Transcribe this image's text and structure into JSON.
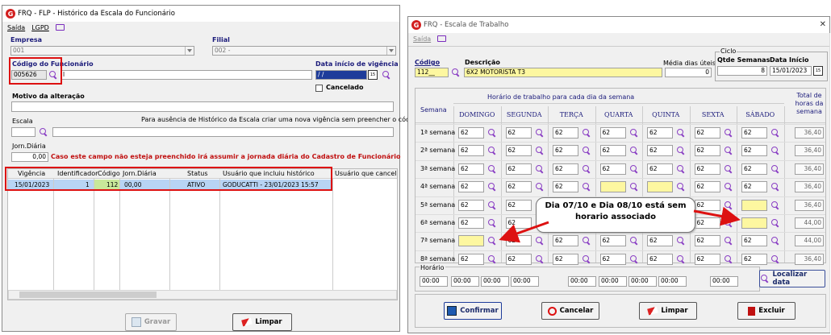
{
  "left": {
    "title": "FRQ - FLP - Histórico da Escala do Funcionário",
    "menu": [
      "Saída",
      "LGPD"
    ],
    "empresa_label": "Empresa",
    "empresa_value": "001",
    "filial_label": "Filial",
    "filial_value": "002 - ",
    "codigo_label": "Código do Funcionário",
    "codigo_value": "005626",
    "codigo_name": "l",
    "data_inicio_label": "Data início de vigência",
    "data_inicio_value": "/ /",
    "cancelado_label": "Cancelado",
    "motivo_label": "Motivo da alteração",
    "escala_label": "Escala",
    "escala_hint": "Para ausência de Histórico da Escala criar uma nova vigência sem preencher o código",
    "jorn_label": "Jorn.Diária",
    "jorn_value": "0,00",
    "jorn_warning": "Caso este campo não esteja preenchido irá assumir a jornada diária do Cadastro de Funcionário",
    "grid_headers": [
      "Vigência",
      "Identificador",
      "Código",
      "Jorn.Diária",
      "Status",
      "Usuário que incluiu histórico",
      "Usuário que cancel"
    ],
    "grid_row": [
      "15/01/2023",
      "1",
      "112",
      "00,00",
      "ATIVO",
      "GODUCATTI - 23/01/2023 15:57",
      ""
    ],
    "btn_gravar": "Gravar",
    "btn_limpar": "Limpar"
  },
  "right": {
    "title": "FRQ - Escala de Trabalho",
    "menu": [
      "Saída"
    ],
    "codigo_label": "Código",
    "codigo_value": "112__",
    "descricao_label": "Descrição",
    "descricao_value": "6X2 MOTORISTA T3",
    "media_label": "Média dias úteis",
    "media_value": "0",
    "ciclo_label": "Ciclo",
    "qtde_label": "Qtde Semanas",
    "qtde_value": "8",
    "data_inicio_label": "Data Início",
    "data_inicio_value": "15/01/2023",
    "horario_header": "Horário de trabalho para cada dia da semana",
    "semana_header": "Semana",
    "total_header": "Total de horas da semana",
    "days": [
      "DOMINGO",
      "SEGUNDA",
      "TERÇA",
      "QUARTA",
      "QUINTA",
      "SEXTA",
      "SÁBADO"
    ],
    "weeks": [
      {
        "label": "1ª semana",
        "cells": [
          "62",
          "62",
          "62",
          "62",
          "62",
          "62",
          "62"
        ],
        "total": "36,40"
      },
      {
        "label": "2ª semana",
        "cells": [
          "62",
          "62",
          "62",
          "62",
          "62",
          "62",
          "62"
        ],
        "total": "36,40"
      },
      {
        "label": "3ª semana",
        "cells": [
          "62",
          "62",
          "62",
          "62",
          "62",
          "62",
          "62"
        ],
        "total": "36,40"
      },
      {
        "label": "4ª semana",
        "cells": [
          "62",
          "62",
          "62",
          "",
          "",
          "62",
          "62"
        ],
        "total": "36,40"
      },
      {
        "label": "5ª semana",
        "cells": [
          "62",
          "62",
          "62",
          "62",
          "62",
          "62",
          ""
        ],
        "total": "36,40"
      },
      {
        "label": "6ª semana",
        "cells": [
          "62",
          "62",
          "62",
          "62",
          "62",
          "62",
          ""
        ],
        "total": "44,00"
      },
      {
        "label": "7ª semana",
        "cells": [
          "",
          "62",
          "62",
          "62",
          "62",
          "62",
          "62"
        ],
        "total": "44,00"
      },
      {
        "label": "8ª semana",
        "cells": [
          "62",
          "62",
          "62",
          "62",
          "62",
          "62",
          "62"
        ],
        "total": "36,40"
      }
    ],
    "horario_label": "Horário",
    "horario_values": [
      "00:00",
      "00:00",
      "00:00",
      "00:00",
      "00:00",
      "00:00",
      "00:00",
      "00:00",
      "00:00"
    ],
    "btn_localizar": "Localizar data",
    "btn_confirmar": "Confirmar",
    "btn_cancelar": "Cancelar",
    "btn_limpar": "Limpar",
    "btn_excluir": "Excluir"
  },
  "callout": "Dia 07/10 e Dia 08/10 está sem horario associado",
  "colors": {
    "yellow": "#fdf7a0",
    "red": "#dd1111",
    "magnifier": "#8a3fc4",
    "selected_row": "#b8d4f4",
    "logo": "#d21f1f"
  }
}
